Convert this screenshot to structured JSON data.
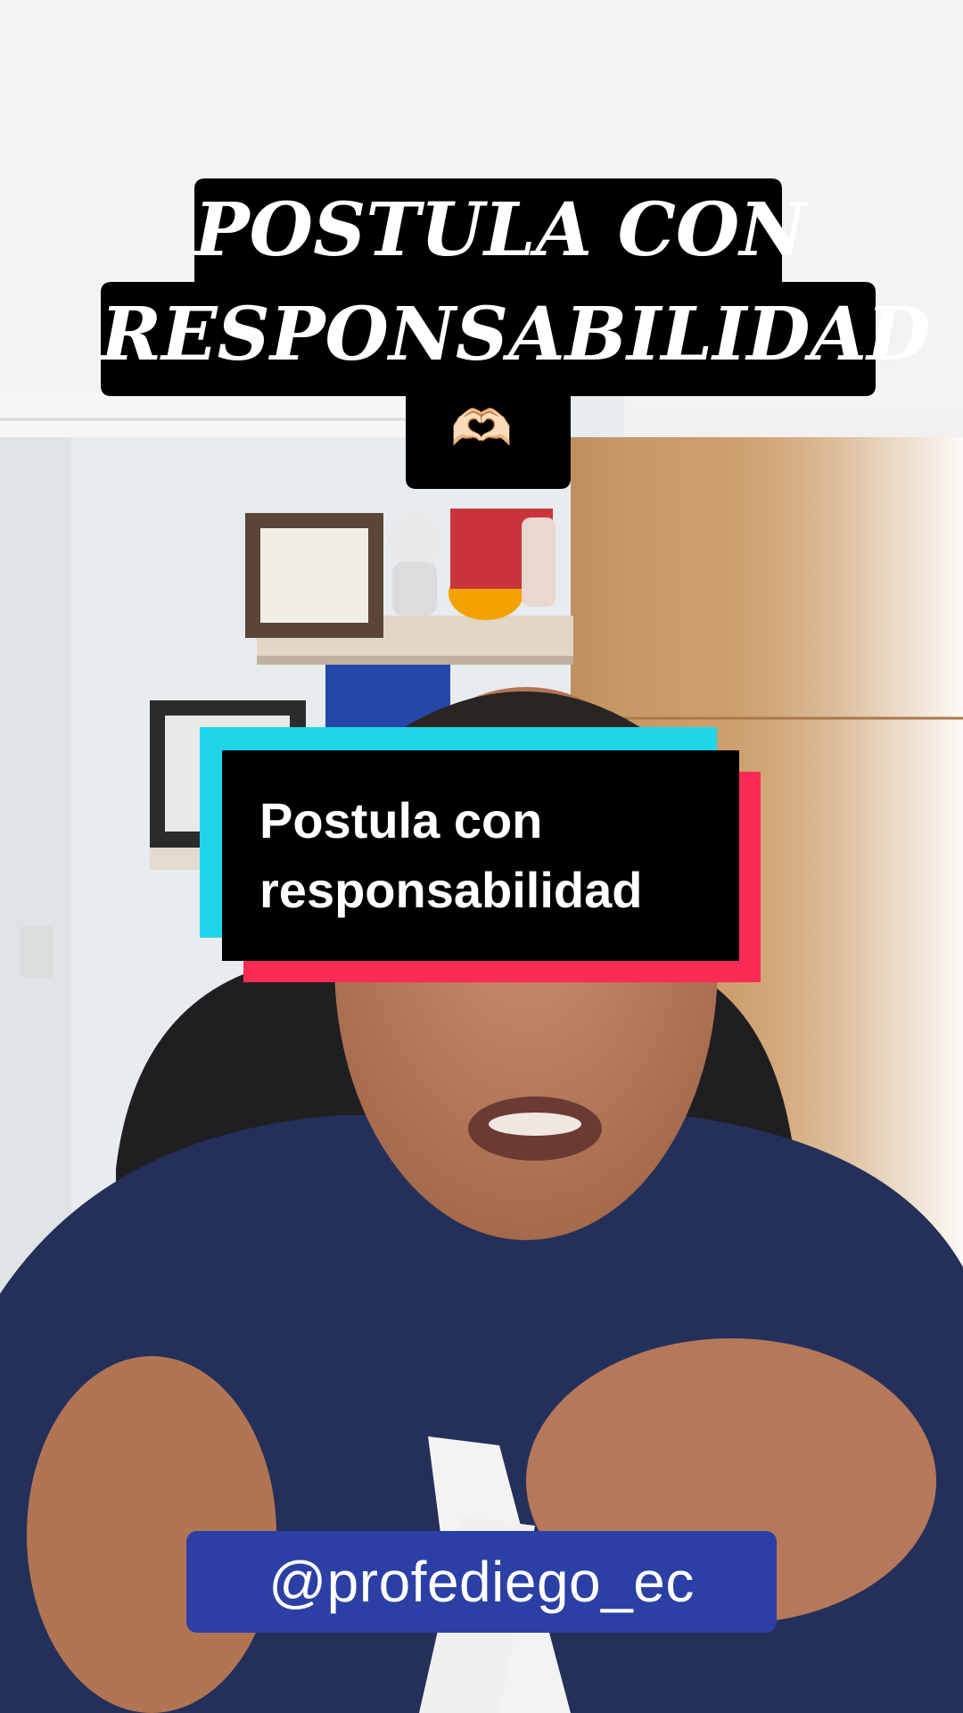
{
  "overlay_title": {
    "line1": "POSTULA CON",
    "line2": "RESPONSABILIDAD",
    "emoji": "🫶🏻"
  },
  "caption": {
    "line1": "Postula con",
    "line2": "responsabilidad"
  },
  "handle": "@profediego_ec",
  "colors": {
    "title_bg": "#000000",
    "caption_cyan": "#1fd5ea",
    "caption_red": "#fb2b56",
    "handle_bg": "#2c3fa5"
  }
}
